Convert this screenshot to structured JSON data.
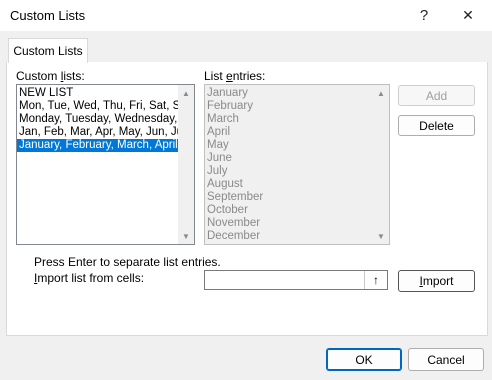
{
  "window": {
    "title": "Custom Lists",
    "help_glyph": "?",
    "close_glyph": "✕"
  },
  "tabs": [
    {
      "label": "Custom Lists"
    }
  ],
  "custom_lists": {
    "label_prefix": "Custom ",
    "label_accel": "l",
    "label_suffix": "ists:",
    "items": [
      "NEW LIST",
      "Mon, Tue, Wed, Thu, Fri, Sat, Sun",
      "Monday, Tuesday, Wednesday, Thursday",
      "Jan, Feb, Mar, Apr, May, Jun, Jul",
      "January, February, March, April"
    ],
    "selected_index": 4
  },
  "list_entries": {
    "label_prefix": "List ",
    "label_accel": "e",
    "label_suffix": "ntries:",
    "items": [
      "January",
      "February",
      "March",
      "April",
      "May",
      "June",
      "July",
      "August",
      "September",
      "October",
      "November",
      "December"
    ]
  },
  "buttons": {
    "add": "Add",
    "delete": "Delete",
    "import_accel": "I",
    "import_rest": "mport",
    "ok": "OK",
    "cancel": "Cancel"
  },
  "hint": "Press Enter to separate list entries.",
  "import_field": {
    "label_accel": "I",
    "label_rest": "mport list from cells:",
    "value": "",
    "collapse_icon": "↑"
  }
}
